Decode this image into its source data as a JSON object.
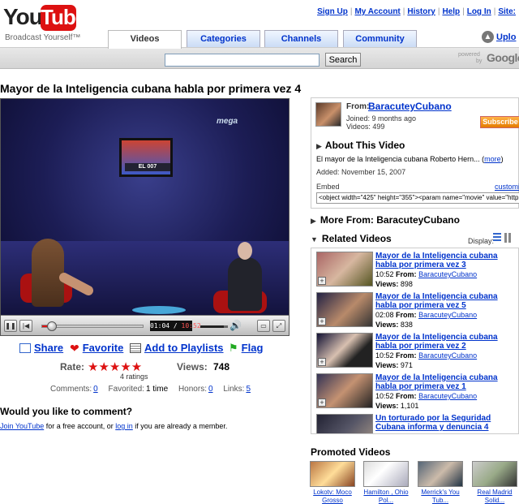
{
  "header": {
    "logo_you": "You",
    "logo_tube": "Tube",
    "tagline": "Broadcast Yourself™",
    "top_links": [
      "Sign Up",
      "My Account",
      "History",
      "Help",
      "Log In",
      "Site:"
    ],
    "tabs": [
      "Videos",
      "Categories",
      "Channels",
      "Community"
    ],
    "active_tab": "Videos",
    "upload_label": "Uplo",
    "search": {
      "value": "",
      "button": "Search"
    },
    "powered_line1": "powered",
    "powered_line2": "by",
    "google": "Google"
  },
  "video": {
    "title": "Mayor de la Inteligencia cubana habla por primera vez 4",
    "tv_caption": "EL 007",
    "network_logo": "mega",
    "player": {
      "current_time": "01:04",
      "total_time": "10:52",
      "progress": 0.098,
      "volume": 0.85
    },
    "actions": [
      "Share",
      "Favorite",
      "Add to Playlists",
      "Flag"
    ],
    "rating": {
      "label": "Rate:",
      "stars": "★★★★★",
      "count": "4 ratings"
    },
    "views": {
      "label": "Views:",
      "value": "748"
    },
    "stats": {
      "comments_label": "Comments:",
      "comments": "0",
      "favorited_label": "Favorited:",
      "favorited": "1 time",
      "honors_label": "Honors:",
      "honors": "0",
      "links_label": "Links:",
      "links": "5"
    },
    "comment_prompt": {
      "heading": "Would you like to comment?",
      "join": "Join YouTube",
      "middle": " for a free account, or ",
      "login": "log in",
      "end": " if you are already a member."
    }
  },
  "uploader": {
    "from_label": "From:",
    "name": "BaracuteyCubano",
    "joined": "Joined: 9 months ago",
    "videos": "Videos: 499",
    "subscribe": "Subscribe",
    "about_heading": "About This Video",
    "description": "El mayor de la Inteligencia cubana Roberto Hern...",
    "more": "more",
    "added": "Added: November 15, 2007",
    "embed_label": "Embed",
    "customize": "customiz",
    "embed_code": "<object width=\"425\" height=\"355\"><param name=\"movie\" value=\"http:"
  },
  "more_from": "More From: BaracuteyCubano",
  "related": {
    "heading": "Related Videos",
    "display_label": "Display:",
    "from_label": "From:",
    "views_label": "Views:",
    "items": [
      {
        "title": "Mayor de la Inteligencia cubana habla por primera vez 3",
        "duration": "10:52",
        "from": "BaracuteyCubano",
        "views": "898"
      },
      {
        "title": "Mayor de la Inteligencia cubana habla por primera vez 5",
        "duration": "02:08",
        "from": "BaracuteyCubano",
        "views": "838"
      },
      {
        "title": "Mayor de la Inteligencia cubana habla por primera vez 2",
        "duration": "10:52",
        "from": "BaracuteyCubano",
        "views": "971"
      },
      {
        "title": "Mayor de la Inteligencia cubana habla por primera vez 1",
        "duration": "10:52",
        "from": "BaracuteyCubano",
        "views": "1,101"
      },
      {
        "title": "Un torturado por la Seguridad Cubana informa y denuncia 4",
        "duration": "",
        "from": "",
        "views": ""
      }
    ]
  },
  "promoted": {
    "heading": "Promoted Videos",
    "items": [
      {
        "label": "Lokotv: Moco Grosso"
      },
      {
        "label": "Hamilton , Ohio Pol..."
      },
      {
        "label": "Merrick's You Tub..."
      },
      {
        "label": "Real Madrid Solid..."
      }
    ]
  },
  "colors": {
    "link": "#0033cc",
    "logo_red": "#dd1111",
    "subscribe_orange": "#e47b00",
    "star_red": "#dd1111"
  }
}
